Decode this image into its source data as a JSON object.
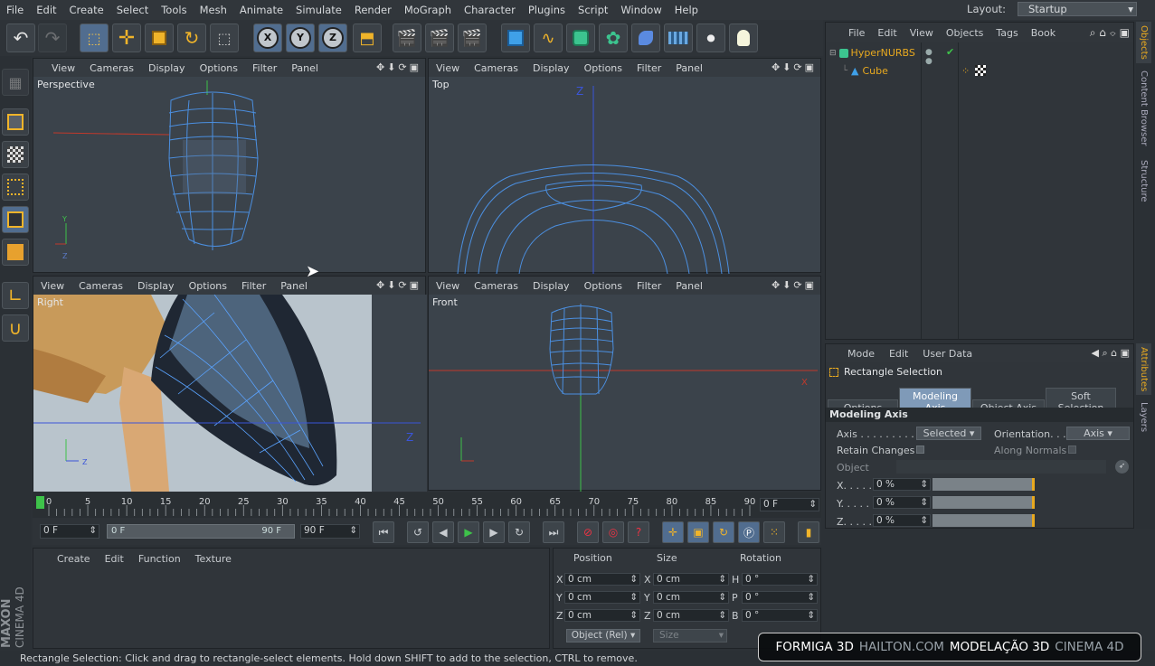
{
  "menu": [
    "File",
    "Edit",
    "Create",
    "Select",
    "Tools",
    "Mesh",
    "Animate",
    "Simulate",
    "Render",
    "MoGraph",
    "Character",
    "Plugins",
    "Script",
    "Window",
    "Help"
  ],
  "layout": {
    "label": "Layout:",
    "value": "Startup"
  },
  "viewport_menu": [
    "View",
    "Cameras",
    "Display",
    "Options",
    "Filter",
    "Panel"
  ],
  "viewports": {
    "perspective": "Perspective",
    "top": "Top",
    "right": "Right",
    "front": "Front"
  },
  "axis_letters": {
    "x": "X",
    "y": "Y",
    "z": "Z"
  },
  "object_manager": {
    "menu": [
      "File",
      "Edit",
      "View",
      "Objects",
      "Tags",
      "Book"
    ],
    "items": [
      {
        "name": "HyperNURBS"
      },
      {
        "name": "Cube"
      }
    ],
    "side_tabs": [
      "Objects",
      "Content Browser",
      "Structure"
    ]
  },
  "attributes": {
    "menu": [
      "Mode",
      "Edit",
      "User Data"
    ],
    "title": "Rectangle Selection",
    "tabs": [
      "Options",
      "Modeling Axis",
      "Object Axis",
      "Soft Selection"
    ],
    "active_tab": "Modeling Axis",
    "section": "Modeling Axis",
    "axis_label": "Axis . . . . . . . . . .",
    "axis_value": "Selected",
    "orientation_label": "Orientation. . .",
    "orientation_value": "Axis",
    "retain_label": "Retain Changes",
    "along_normals_label": "Along Normals",
    "object_label": "Object",
    "x_label": "X. . . . .",
    "y_label": "Y. . . . .",
    "z_label": "Z. . . . .",
    "x_value": "0 %",
    "y_value": "0 %",
    "z_value": "0 %",
    "side_tabs": [
      "Attributes",
      "Layers"
    ]
  },
  "timeline": {
    "ticks": [
      "0",
      "5",
      "10",
      "15",
      "20",
      "25",
      "30",
      "35",
      "40",
      "45",
      "50",
      "55",
      "60",
      "65",
      "70",
      "75",
      "80",
      "85",
      "90"
    ],
    "current": "0 F",
    "start": "0 F",
    "range_start": "0 F",
    "range_end": "90 F",
    "end": "90 F"
  },
  "material_menu": [
    "Create",
    "Edit",
    "Function",
    "Texture"
  ],
  "coords": {
    "headers": [
      "Position",
      "Size",
      "Rotation"
    ],
    "rows": [
      {
        "a": "X",
        "av": "0 cm",
        "b": "X",
        "bv": "0 cm",
        "c": "H",
        "cv": "0 °"
      },
      {
        "a": "Y",
        "av": "0 cm",
        "b": "Y",
        "bv": "0 cm",
        "c": "P",
        "cv": "0 °"
      },
      {
        "a": "Z",
        "av": "0 cm",
        "b": "Z",
        "bv": "0 cm",
        "c": "B",
        "cv": "0 °"
      }
    ],
    "mode": "Object (Rel)",
    "size_mode": "Size"
  },
  "brand": {
    "line1": "MAXON",
    "line2": "CINEMA 4D"
  },
  "status": "Rectangle Selection: Click and drag to rectangle-select elements. Hold down SHIFT to add to the selection, CTRL to remove.",
  "watermark": {
    "a": "FORMIGA 3D",
    "b": "HAILTON.COM",
    "c": "MODELAÇÃO 3D",
    "d": "CINEMA 4D"
  },
  "colors": {
    "accent": "#7f9ab8",
    "wire": "#4b8fe0",
    "axis_red": "#c0392b",
    "axis_blue": "#3a55d9",
    "axis_green": "#3ec24a",
    "slider": "#e8a91f"
  }
}
